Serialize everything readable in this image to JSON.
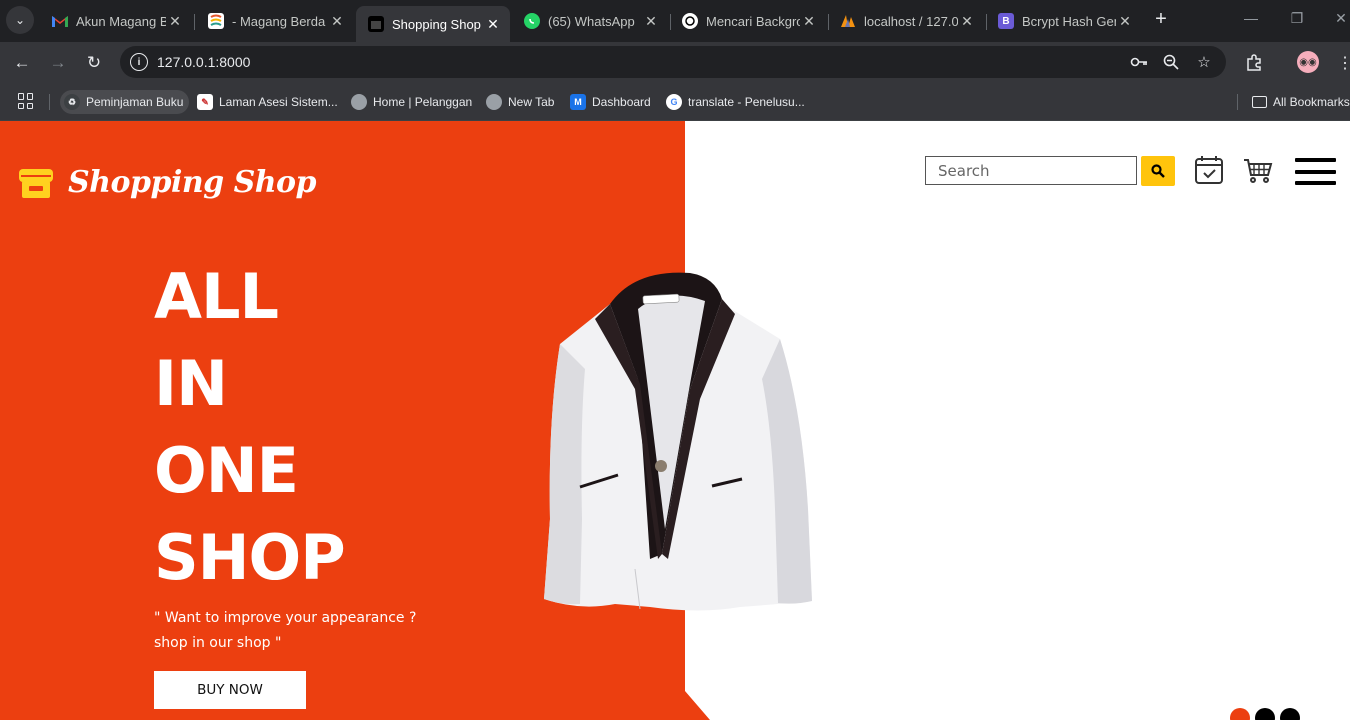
{
  "browser": {
    "tabs": [
      {
        "label": "Akun Magang Be",
        "favicon": "gmail-icon",
        "active": false
      },
      {
        "label": "- Magang Berda",
        "favicon": "doc-icon",
        "active": false
      },
      {
        "label": "Shopping Shop",
        "favicon": "shop-icon",
        "active": true
      },
      {
        "label": "(65) WhatsApp",
        "favicon": "whatsapp-icon",
        "active": false
      },
      {
        "label": "Mencari Backgro",
        "favicon": "chatgpt-icon",
        "active": false
      },
      {
        "label": "localhost / 127.0",
        "favicon": "phpmyadmin-icon",
        "active": false
      },
      {
        "label": "Bcrypt Hash Gen",
        "favicon": "bcrypt-icon",
        "active": false
      }
    ],
    "url": "127.0.0.1:8000",
    "bookmarks": [
      {
        "label": "Peminjaman Buku",
        "icon": "recycle-icon"
      },
      {
        "label": "Laman Asesi Sistem...",
        "icon": "asesi-icon"
      },
      {
        "label": "Home | Pelanggan",
        "icon": "globe-icon"
      },
      {
        "label": "New Tab",
        "icon": "globe-icon"
      },
      {
        "label": "Dashboard",
        "icon": "m-icon"
      },
      {
        "label": "translate - Penelusu...",
        "icon": "google-icon"
      }
    ],
    "all_bookmarks_label": "All Bookmarks"
  },
  "site": {
    "brand": "Shopping Shop",
    "headline": [
      "ALL",
      "IN",
      "ONE",
      "SHOP"
    ],
    "tagline_line1": "\" Want to improve your appearance ?",
    "tagline_line2": "shop in our shop \"",
    "buy_label": "BUY NOW",
    "search_placeholder": "Search",
    "accent_color": "#ec3f10",
    "search_button_color": "#ffc40c",
    "slides": 3,
    "active_slide": 1
  }
}
